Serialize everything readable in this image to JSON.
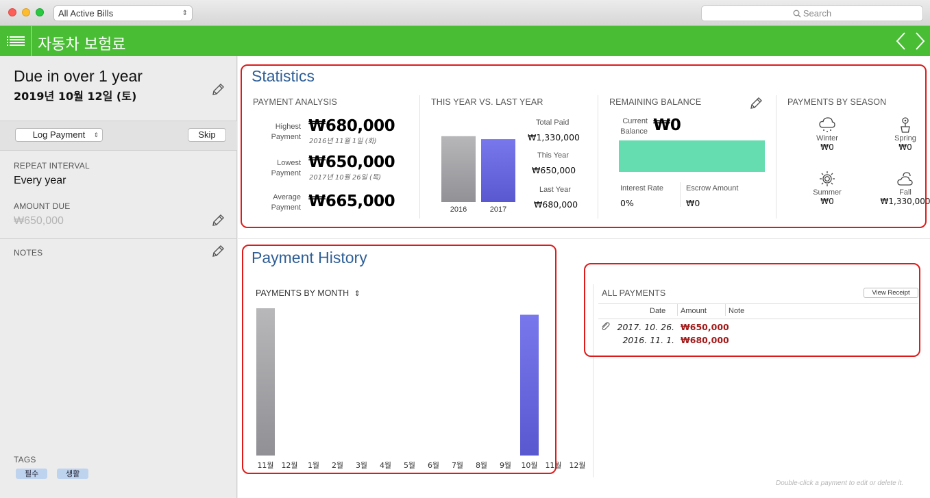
{
  "titlebar": {
    "filter": "All Active Bills",
    "search_placeholder": "Search"
  },
  "header": {
    "title": "자동차 보험료"
  },
  "sidebar": {
    "due_title": "Due in over 1 year",
    "due_date": "2019년 10월 12일 (토)",
    "log_payment": "Log Payment",
    "skip": "Skip",
    "repeat_label": "REPEAT INTERVAL",
    "repeat_value": "Every year",
    "amount_label": "AMOUNT DUE",
    "amount_value": "₩650,000",
    "notes_label": "NOTES",
    "tags_label": "TAGS",
    "tags": [
      "필수",
      "생활"
    ]
  },
  "statistics": {
    "title": "Statistics",
    "payment_analysis": {
      "label": "PAYMENT ANALYSIS",
      "highest_label_1": "Highest",
      "highest_label_2": "Payment",
      "highest_value": "₩680,000",
      "highest_date": "2016년 11월 1일 (화)",
      "lowest_label_1": "Lowest",
      "lowest_label_2": "Payment",
      "lowest_value": "₩650,000",
      "lowest_date": "2017년 10월 26일 (목)",
      "average_label_1": "Average",
      "average_label_2": "Payment",
      "average_value": "₩665,000"
    },
    "year_vs_last": {
      "label": "THIS YEAR VS. LAST YEAR",
      "total_paid_label": "Total Paid",
      "total_paid_value": "₩1,330,000",
      "this_year_label": "This Year",
      "this_year_value": "₩650,000",
      "last_year_label": "Last Year",
      "last_year_value": "₩680,000",
      "bar_2016_label": "2016",
      "bar_2017_label": "2017",
      "bar_2016_value": 680000,
      "bar_2017_value": 650000
    },
    "remaining_balance": {
      "label": "REMAINING BALANCE",
      "current_label_1": "Current",
      "current_label_2": "Balance",
      "current_value": "₩0",
      "interest_label": "Interest Rate",
      "interest_value": "0%",
      "escrow_label": "Escrow Amount",
      "escrow_value": "₩0",
      "bar_color": "#66ddb0"
    },
    "seasons": {
      "label": "PAYMENTS BY SEASON",
      "winter_name": "Winter",
      "winter_value": "₩0",
      "winter_icon": "snow-cloud-icon",
      "spring_name": "Spring",
      "spring_value": "₩0",
      "spring_icon": "flower-pot-icon",
      "summer_name": "Summer",
      "summer_value": "₩0",
      "summer_icon": "sun-icon",
      "fall_name": "Fall",
      "fall_value": "₩1,330,000",
      "fall_icon": "sun-cloud-icon"
    }
  },
  "history": {
    "title": "Payment History",
    "chart_label": "PAYMENTS BY MONTH",
    "months": [
      "11월",
      "12월",
      "1월",
      "2월",
      "3월",
      "4월",
      "5월",
      "6월",
      "7월",
      "8월",
      "9월",
      "10월",
      "11월",
      "12월"
    ]
  },
  "payments": {
    "label": "ALL PAYMENTS",
    "view_receipt": "View Receipt",
    "col_date": "Date",
    "col_amount": "Amount",
    "col_note": "Note",
    "rows": [
      {
        "date": "2017. 10. 26.",
        "amount": "₩650,000"
      },
      {
        "date": "2016. 11. 1.",
        "amount": "₩680,000"
      }
    ],
    "hint": "Double-click a payment to edit or delete it."
  },
  "colors": {
    "accent_green": "#49bd34",
    "section_blue": "#2f5f96",
    "amount_red": "#a21a1a",
    "bar_purple": "#6b6be0",
    "bar_gray": "#a5a5a5"
  },
  "chart_data": [
    {
      "type": "bar",
      "categories": [
        "2016",
        "2017"
      ],
      "values": [
        680000,
        650000
      ],
      "ylim": [
        0,
        700000
      ]
    },
    {
      "type": "bar",
      "categories": [
        "11월",
        "12월",
        "1월",
        "2월",
        "3월",
        "4월",
        "5월",
        "6월",
        "7월",
        "8월",
        "9월",
        "10월",
        "11월",
        "12월"
      ],
      "values": [
        680000,
        0,
        0,
        0,
        0,
        0,
        0,
        0,
        0,
        0,
        0,
        650000,
        0,
        0
      ],
      "ylim": [
        0,
        680000
      ]
    }
  ]
}
